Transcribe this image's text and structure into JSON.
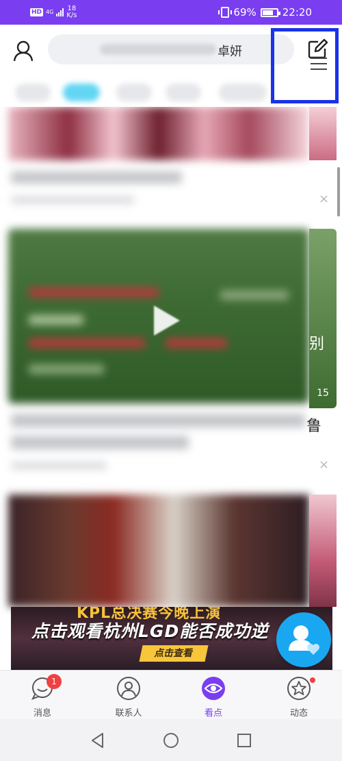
{
  "status_bar": {
    "network_badge": "HD",
    "network_type": "4G",
    "speed_value": "18",
    "speed_unit": "K/s",
    "battery": "69%",
    "time": "22:20"
  },
  "header": {
    "search_keyword": "卓妍",
    "icons": [
      "user-icon",
      "edit-icon",
      "menu-icon"
    ],
    "highlight_color": "#1a32e8"
  },
  "feed": {
    "peek_right": [
      "别",
      "鲁"
    ],
    "duration_peek": "15",
    "close_symbol": "×"
  },
  "banner": {
    "top_text": "KPL总决赛今晚上演",
    "main_text": "点击观看杭州LGD能否成功逆",
    "button_label": "点击查看"
  },
  "bottom_nav": {
    "items": [
      {
        "label": "消息",
        "icon": "chat-bubble-icon",
        "badge": "1"
      },
      {
        "label": "联系人",
        "icon": "contacts-icon"
      },
      {
        "label": "看点",
        "icon": "eye-icon",
        "active": true
      },
      {
        "label": "动态",
        "icon": "star-icon",
        "dot": true
      }
    ]
  },
  "system_nav": {
    "icons": [
      "back-icon",
      "home-icon",
      "recents-icon"
    ]
  },
  "colors": {
    "accent": "#7a3ef0",
    "badge": "#f04040",
    "float_button": "#1aa7f2"
  }
}
